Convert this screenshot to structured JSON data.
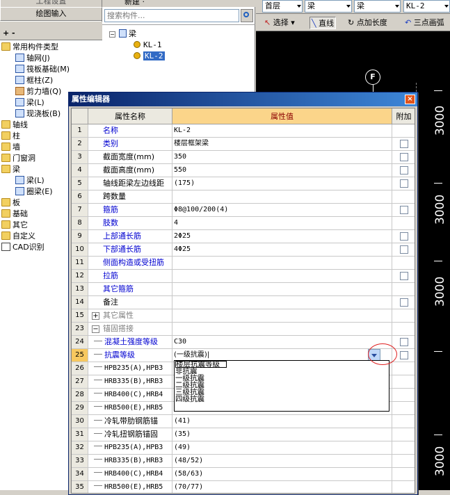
{
  "left_panel": {
    "top_module": "工程设置",
    "drawing_module": "绘图输入",
    "tree_ctrl": "+ -",
    "tree": [
      {
        "label": "常用构件类型",
        "level": 0
      },
      {
        "label": "轴网(J)",
        "level": 1
      },
      {
        "label": "筏板基础(M)",
        "level": 1
      },
      {
        "label": "框柱(Z)",
        "level": 1
      },
      {
        "label": "剪力墙(Q)",
        "level": 1
      },
      {
        "label": "梁(L)",
        "level": 1
      },
      {
        "label": "现浇板(B)",
        "level": 1
      },
      {
        "label": "轴线",
        "level": 0
      },
      {
        "label": "柱",
        "level": 0
      },
      {
        "label": "墙",
        "level": 0
      },
      {
        "label": "门窗洞",
        "level": 0
      },
      {
        "label": "梁",
        "level": 0
      },
      {
        "label": "梁(L)",
        "level": 1
      },
      {
        "label": "圈梁(E)",
        "level": 1
      },
      {
        "label": "板",
        "level": 0
      },
      {
        "label": "基础",
        "level": 0
      },
      {
        "label": "其它",
        "level": 0
      },
      {
        "label": "自定义",
        "level": 0
      },
      {
        "label": "CAD识别",
        "level": 0
      }
    ]
  },
  "mid_panel": {
    "new_label": "新建 ·",
    "search_placeholder": "搜索构件...",
    "root": "梁",
    "items": [
      "KL-1",
      "KL-2"
    ],
    "selected": "KL-2"
  },
  "top_bar": {
    "floor": "首层",
    "type1": "梁",
    "type2": "梁",
    "component": "KL-2",
    "select_label": "选择",
    "line_label": "直线",
    "point_length_label": "点加长度",
    "three_point_label": "三点画弧"
  },
  "drawing": {
    "axis_label": "F",
    "dims": [
      "3000",
      "3000",
      "3000",
      "3000"
    ]
  },
  "dialog": {
    "title": "属性编辑器",
    "close": "×",
    "headers": {
      "num": "",
      "name": "属性名称",
      "value": "属性值",
      "extra": "附加"
    },
    "rows": [
      {
        "num": "1",
        "name": "名称",
        "value": "KL-2"
      },
      {
        "num": "2",
        "name": "类别",
        "value": "楼层框架梁"
      },
      {
        "num": "3",
        "name": "截面宽度(mm)",
        "value": "350"
      },
      {
        "num": "4",
        "name": "截面高度(mm)",
        "value": "550"
      },
      {
        "num": "5",
        "name": "轴线距梁左边线距",
        "value": "(175)"
      },
      {
        "num": "6",
        "name": "跨数量",
        "value": ""
      },
      {
        "num": "7",
        "name": "箍筋",
        "value": "Φ8@100/200(4)"
      },
      {
        "num": "8",
        "name": "肢数",
        "value": "4"
      },
      {
        "num": "9",
        "name": "上部通长筋",
        "value": "2Φ25"
      },
      {
        "num": "10",
        "name": "下部通长筋",
        "value": "4Φ25"
      },
      {
        "num": "11",
        "name": "侧面构造或受扭筋",
        "value": ""
      },
      {
        "num": "12",
        "name": "拉筋",
        "value": ""
      },
      {
        "num": "13",
        "name": "其它箍筋",
        "value": ""
      },
      {
        "num": "14",
        "name": "备注",
        "value": ""
      },
      {
        "num": "15",
        "name": "其它属性",
        "value": ""
      },
      {
        "num": "23",
        "name": "锚固搭接",
        "value": ""
      },
      {
        "num": "24",
        "name": "混凝土强度等级",
        "value": "C30"
      },
      {
        "num": "25",
        "name": "抗震等级",
        "value": "(一级抗震)"
      },
      {
        "num": "26",
        "name": "HPB235(A),HPB3",
        "value": ""
      },
      {
        "num": "27",
        "name": "HRB335(B),HRB3",
        "value": ""
      },
      {
        "num": "28",
        "name": "HRB400(C),HRB4",
        "value": ""
      },
      {
        "num": "29",
        "name": "HRB500(E),HRB5",
        "value": ""
      },
      {
        "num": "30",
        "name": "冷轧带肋钢筋锚",
        "value": "(41)"
      },
      {
        "num": "31",
        "name": "冷轧扭钢筋锚固",
        "value": "(35)"
      },
      {
        "num": "32",
        "name": "HPB235(A),HPB3",
        "value": "(49)"
      },
      {
        "num": "33",
        "name": "HRB335(B),HRB3",
        "value": "(48/52)"
      },
      {
        "num": "34",
        "name": "HRB400(C),HRB4",
        "value": "(58/63)"
      },
      {
        "num": "35",
        "name": "HRB500(E),HRB5",
        "value": "(70/77)"
      }
    ],
    "dropdown_options": [
      "楼层抗震等级",
      "非抗震",
      "一级抗震",
      "二级抗震",
      "三级抗震",
      "四级抗震"
    ]
  },
  "colors": {
    "title_bar": "#0a246a",
    "value_header": "#fbd58a",
    "link_text": "#0000d0",
    "highlight": "#316ac5",
    "annotation_circle": "#e02020"
  }
}
